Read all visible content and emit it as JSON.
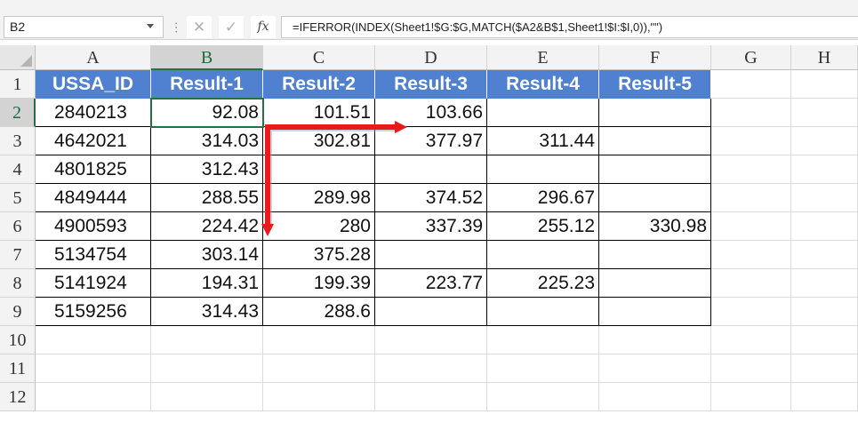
{
  "formula_bar": {
    "name_box": "B2",
    "cancel_glyph": "✕",
    "enter_glyph": "✓",
    "fx_glyph": "fx",
    "formula": "=IFERROR(INDEX(Sheet1!$G:$G,MATCH($A2&B$1,Sheet1!$I:$I,0)),\"\")"
  },
  "columns": [
    "A",
    "B",
    "C",
    "D",
    "E",
    "F",
    "G",
    "H"
  ],
  "rows": [
    "1",
    "2",
    "3",
    "4",
    "5",
    "6",
    "7",
    "8",
    "9",
    "10",
    "11",
    "12"
  ],
  "selected_cell": "B2",
  "table": {
    "headers": [
      "USSA_ID",
      "Result-1",
      "Result-2",
      "Result-3",
      "Result-4",
      "Result-5"
    ],
    "body": [
      [
        "2840213",
        "92.08",
        "101.51",
        "103.66",
        "",
        ""
      ],
      [
        "4642021",
        "314.03",
        "302.81",
        "377.97",
        "311.44",
        ""
      ],
      [
        "4801825",
        "312.43",
        "",
        "",
        "",
        ""
      ],
      [
        "4849444",
        "288.55",
        "289.98",
        "374.52",
        "296.67",
        ""
      ],
      [
        "4900593",
        "224.42",
        "280",
        "337.39",
        "255.12",
        "330.98"
      ],
      [
        "5134754",
        "303.14",
        "375.28",
        "",
        "",
        ""
      ],
      [
        "5141924",
        "194.31",
        "199.39",
        "223.77",
        "225.23",
        ""
      ],
      [
        "5159256",
        "314.43",
        "288.6",
        "",
        "",
        ""
      ]
    ]
  },
  "annotation": {
    "arrow_color": "#e81b1b"
  },
  "colors": {
    "header_fill": "#4f81d0",
    "selection": "#217346"
  }
}
